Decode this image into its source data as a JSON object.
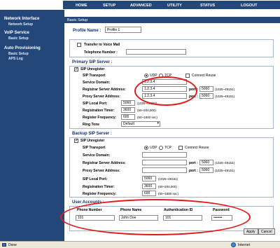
{
  "nav": {
    "items": [
      "HOME",
      "SETUP",
      "ADVANCED",
      "UTILITY",
      "STATUS",
      "LOGOUT"
    ]
  },
  "sidebar": {
    "groups": [
      {
        "title": "Network Interface",
        "items": [
          "Network Setup"
        ]
      },
      {
        "title": "VoIP Service",
        "items": [
          "Basic Setup"
        ]
      },
      {
        "title": "Auto Provisioning",
        "items": [
          "Basic Setup",
          "APS Log"
        ]
      }
    ]
  },
  "main": {
    "title": "Basic Setup",
    "profile_label": "Profile Name :",
    "profile_value": "Profile 1",
    "voicemail": {
      "label": "Transfer to Voice Mail",
      "phone_label": "Telephone Number :",
      "phone_value": ""
    },
    "primary": {
      "title": "Primary SIP Server :",
      "unregister": "SIP Unregister",
      "transport_label": "SIP Transport",
      "udp": "UDP",
      "tcp": "TCP",
      "reuse": "Connect Reuse",
      "domain_label": "Service Domain:",
      "domain_value": "1.2.3.4",
      "registrar_label": "Registrar Server Address:",
      "registrar_value": "1.2.3.4",
      "proxy_label": "Proxy Server Address:",
      "proxy_value": "1.2.3.4",
      "port_label": "port :",
      "registrar_port": "5060",
      "proxy_port": "5060",
      "port_hint": "(1025~49151)",
      "local_port_label": "SIP Local Port:",
      "local_port": "5060",
      "local_port_hint": "(1025~49151)",
      "reg_timer_label": "Registration Timer:",
      "reg_timer": "3600",
      "reg_timer_hint": "(60~200,000)",
      "reg_freq_label": "Register Frequency:",
      "reg_freq": "600",
      "reg_freq_hint": "(60~1800 sec)",
      "ring_label": "Ring Tone",
      "ring_value": "Default"
    },
    "backup": {
      "title": "Backup SIP Server :",
      "unregister": "SIP Unregister",
      "transport_label": "SIP Transport",
      "udp": "UDP",
      "tcp": "TCP",
      "reuse": "Connect Reuse",
      "domain_label": "Service Domain:",
      "registrar_label": "Registrar Server Address:",
      "proxy_label": "Proxy Server Address:",
      "port_label": "port :",
      "registrar_port": "5060",
      "proxy_port": "5060",
      "port_hint": "(1025~49151)",
      "local_port_label": "SIP Local Port:",
      "local_port": "5060",
      "local_port_hint": "(1025~49151)",
      "reg_timer_label": "Registration Timer:",
      "reg_timer": "3600",
      "reg_timer_hint": "(60~200,000)",
      "reg_freq_label": "Register Frequency:",
      "reg_freq": "600",
      "reg_freq_hint": "(60~1800 sec)"
    },
    "accounts": {
      "title": "User Accounts :",
      "headers": [
        "Phone Number",
        "Phone Name",
        "Authentication ID",
        "Password"
      ],
      "values": [
        "101",
        "John Doe",
        "101",
        "•••••••"
      ]
    },
    "apply": "Apply",
    "cancel": "Cancel"
  },
  "status": {
    "left": "Done",
    "right": "Internet"
  }
}
